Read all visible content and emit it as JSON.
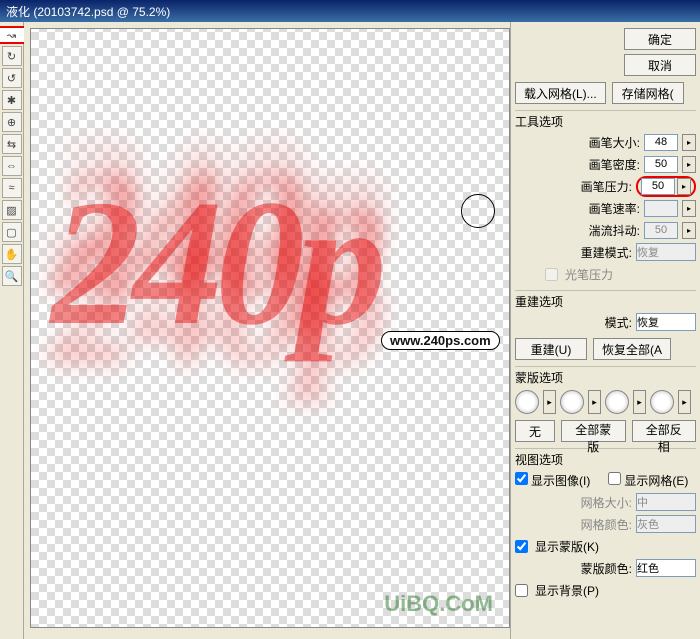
{
  "title": "液化 (20103742.psd @ 75.2%)",
  "buttons": {
    "ok": "确定",
    "cancel": "取消",
    "load_mesh": "载入网格(L)...",
    "save_mesh": "存储网格(",
    "reconstruct": "重建(U)",
    "restore_all": "恢复全部(A",
    "none": "无",
    "mask_all": "全部蒙版",
    "invert_all": "全部反相"
  },
  "groups": {
    "tool_options": "工具选项",
    "reconstruct_options": "重建选项",
    "mask_options": "蒙版选项",
    "view_options": "视图选项"
  },
  "fields": {
    "brush_size": {
      "label": "画笔大小:",
      "value": "48"
    },
    "brush_density": {
      "label": "画笔密度:",
      "value": "50"
    },
    "brush_pressure": {
      "label": "画笔压力:",
      "value": "50"
    },
    "brush_rate": {
      "label": "画笔速率:",
      "value": ""
    },
    "turbulence": {
      "label": "湍流抖动:",
      "value": "50"
    },
    "reconstruct_mode": {
      "label": "重建模式:",
      "value": "恢复"
    },
    "stylus": "光笔压力",
    "mode": {
      "label": "模式:",
      "value": "恢复"
    },
    "show_image": "显示图像(I)",
    "show_mesh": "显示网格(E)",
    "mesh_size": {
      "label": "网格大小:",
      "value": "中"
    },
    "mesh_color": {
      "label": "网格颜色:",
      "value": "灰色"
    },
    "show_mask": "显示蒙版(K)",
    "mask_color": {
      "label": "蒙版颜色:",
      "value": "红色"
    },
    "show_bg": "显示背景(P)"
  },
  "canvas": {
    "artwork": "240p",
    "watermark1": "www.240ps.com",
    "watermark2": "UiBQ.CoM"
  },
  "icons": {
    "warp": "↝",
    "twirl_r": "↻",
    "twirl_l": "↺",
    "pucker": "✱",
    "bloat": "⊕",
    "push": "⇆",
    "mirror": "⇔",
    "turb": "≈",
    "freeze": "▨",
    "thaw": "▢",
    "hand": "✋",
    "zoom": "🔍",
    "tri": "▸"
  }
}
